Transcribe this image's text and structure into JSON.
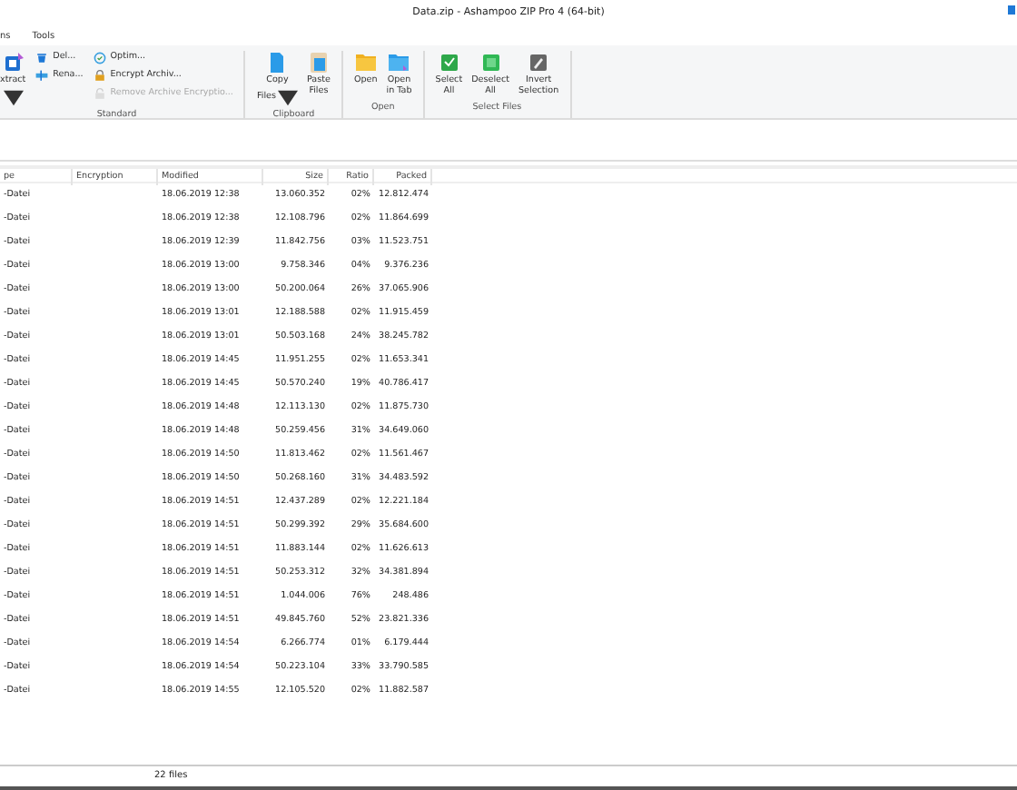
{
  "window": {
    "title": "Data.zip - Ashampoo ZIP Pro 4 (64-bit)"
  },
  "menu_tabs": [
    {
      "label": "ns",
      "selected": false
    },
    {
      "label": "Tools",
      "selected": false
    }
  ],
  "ribbon_groups": [
    {
      "title": "Standard",
      "items": [
        {
          "kind": "large",
          "label": "xtract",
          "caret": true,
          "disabled": false
        },
        {
          "kind": "stack",
          "entries": [
            {
              "label": "Del...",
              "disabled": false
            },
            {
              "label": "Rena...",
              "disabled": false
            }
          ]
        },
        {
          "kind": "stack",
          "entries": [
            {
              "label": "Optim...",
              "disabled": false
            },
            {
              "label": "Encrypt Archiv...",
              "disabled": false
            },
            {
              "label": "Remove Archive Encryptio...",
              "disabled": true
            }
          ]
        }
      ]
    },
    {
      "title": "Clipboard",
      "items": [
        {
          "kind": "large",
          "label": "Copy Files",
          "caret": true,
          "disabled": false
        },
        {
          "kind": "large",
          "label": "Paste Files",
          "caret": false,
          "disabled": false
        }
      ]
    },
    {
      "title": "Open",
      "items": [
        {
          "kind": "large",
          "label": "Open",
          "caret": false,
          "disabled": false
        },
        {
          "kind": "large",
          "label": "Open in Tab",
          "caret": false,
          "disabled": false
        }
      ]
    },
    {
      "title": "Select Files",
      "items": [
        {
          "kind": "large",
          "label": "Select All",
          "caret": false,
          "disabled": false
        },
        {
          "kind": "large",
          "label": "Deselect All",
          "caret": false,
          "disabled": false
        },
        {
          "kind": "large",
          "label": "Invert Selection",
          "caret": false,
          "disabled": false
        }
      ]
    }
  ],
  "table": {
    "columns": [
      "pe",
      "Encryption",
      "Modified",
      "Size",
      "Ratio",
      "Packed"
    ],
    "rows": [
      [
        "-Datei",
        "",
        "18.06.2019 12:38",
        "13.060.352",
        "02%",
        "12.812.474"
      ],
      [
        "-Datei",
        "",
        "18.06.2019 12:38",
        "12.108.796",
        "02%",
        "11.864.699"
      ],
      [
        "-Datei",
        "",
        "18.06.2019 12:39",
        "11.842.756",
        "03%",
        "11.523.751"
      ],
      [
        "-Datei",
        "",
        "18.06.2019 13:00",
        "9.758.346",
        "04%",
        "9.376.236"
      ],
      [
        "-Datei",
        "",
        "18.06.2019 13:00",
        "50.200.064",
        "26%",
        "37.065.906"
      ],
      [
        "-Datei",
        "",
        "18.06.2019 13:01",
        "12.188.588",
        "02%",
        "11.915.459"
      ],
      [
        "-Datei",
        "",
        "18.06.2019 13:01",
        "50.503.168",
        "24%",
        "38.245.782"
      ],
      [
        "-Datei",
        "",
        "18.06.2019 14:45",
        "11.951.255",
        "02%",
        "11.653.341"
      ],
      [
        "-Datei",
        "",
        "18.06.2019 14:45",
        "50.570.240",
        "19%",
        "40.786.417"
      ],
      [
        "-Datei",
        "",
        "18.06.2019 14:48",
        "12.113.130",
        "02%",
        "11.875.730"
      ],
      [
        "-Datei",
        "",
        "18.06.2019 14:48",
        "50.259.456",
        "31%",
        "34.649.060"
      ],
      [
        "-Datei",
        "",
        "18.06.2019 14:50",
        "11.813.462",
        "02%",
        "11.561.467"
      ],
      [
        "-Datei",
        "",
        "18.06.2019 14:50",
        "50.268.160",
        "31%",
        "34.483.592"
      ],
      [
        "-Datei",
        "",
        "18.06.2019 14:51",
        "12.437.289",
        "02%",
        "12.221.184"
      ],
      [
        "-Datei",
        "",
        "18.06.2019 14:51",
        "50.299.392",
        "29%",
        "35.684.600"
      ],
      [
        "-Datei",
        "",
        "18.06.2019 14:51",
        "11.883.144",
        "02%",
        "11.626.613"
      ],
      [
        "-Datei",
        "",
        "18.06.2019 14:51",
        "50.253.312",
        "32%",
        "34.381.894"
      ],
      [
        "-Datei",
        "",
        "18.06.2019 14:51",
        "1.044.006",
        "76%",
        "248.486"
      ],
      [
        "-Datei",
        "",
        "18.06.2019 14:51",
        "49.845.760",
        "52%",
        "23.821.336"
      ],
      [
        "-Datei",
        "",
        "18.06.2019 14:54",
        "6.266.774",
        "01%",
        "6.179.444"
      ],
      [
        "-Datei",
        "",
        "18.06.2019 14:54",
        "50.223.104",
        "33%",
        "33.790.585"
      ],
      [
        "-Datei",
        "",
        "18.06.2019 14:55",
        "12.105.520",
        "02%",
        "11.882.587"
      ]
    ]
  },
  "status_bar": {
    "count": "22 files"
  }
}
